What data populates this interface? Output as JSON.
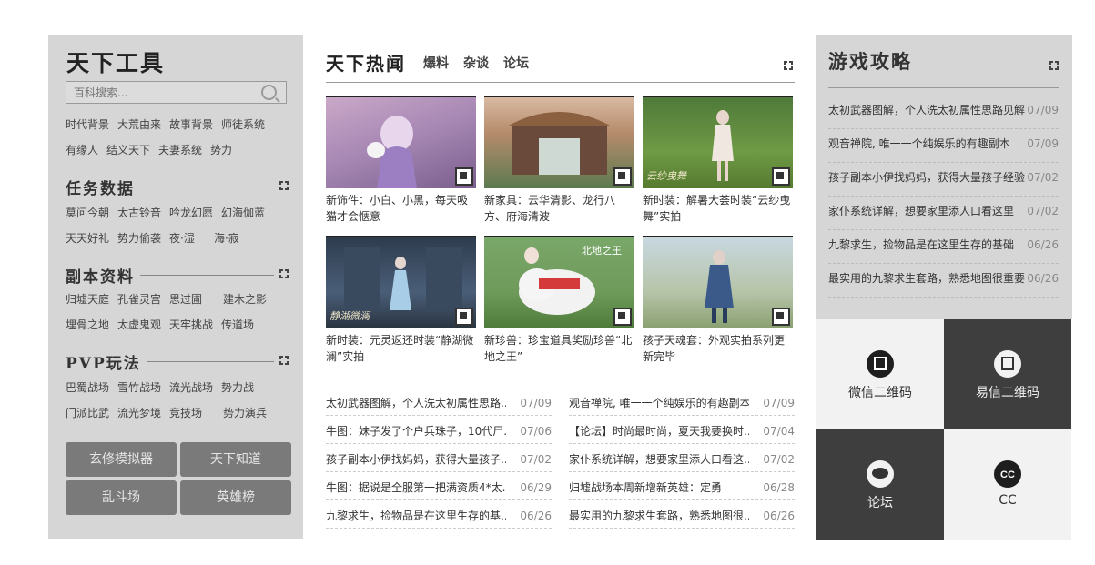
{
  "tools": {
    "title": "天下工具",
    "search_placeholder": "百科搜索...",
    "links_rows": [
      [
        "时代背景",
        "大荒由来",
        "故事背景",
        "师徒系统"
      ],
      [
        "有缘人",
        "结义天下",
        "夫妻系统",
        "势力"
      ]
    ],
    "sections": [
      {
        "label": "任务数据",
        "rows": [
          [
            "莫问今朝",
            "太古铃音",
            "吟龙幻愿",
            "幻海伽蓝"
          ],
          [
            "天天好礼",
            "势力偷袭",
            "夜·湿",
            "海·寂"
          ]
        ]
      },
      {
        "label": "副本资料",
        "rows": [
          [
            "归墟天庭",
            "孔雀灵宫",
            "思过圃",
            "建木之影"
          ],
          [
            "埋骨之地",
            "太虚鬼观",
            "天牢挑战",
            "传道场"
          ]
        ]
      },
      {
        "label": "PVP玩法",
        "rows": [
          [
            "巴蜀战场",
            "雪竹战场",
            "流光战场",
            "势力战"
          ],
          [
            "门派比武",
            "流光梦境",
            "竞技场",
            "势力演兵"
          ]
        ]
      }
    ],
    "buttons": [
      "玄修模拟器",
      "天下知道",
      "乱斗场",
      "英雄榜"
    ]
  },
  "hot": {
    "title": "天下热闻",
    "tabs": [
      "爆料",
      "杂谈",
      "论坛"
    ],
    "cards": [
      {
        "caption": "新饰件：小白、小黑，每天吸猫才会惬意"
      },
      {
        "caption": "新家具：云华清影、龙行八方、府海清波"
      },
      {
        "caption": "新时装：解暑大荟时装“云纱曳舞”实拍",
        "overlay": "云纱曳舞"
      },
      {
        "caption": "新时装：元灵返还时装“静湖微澜”实拍",
        "overlay": "静湖微澜"
      },
      {
        "caption": "新珍兽：珍宝道具奖励珍兽“北地之王”",
        "overlay": "北地之王"
      },
      {
        "caption": "孩子天魂套：外观实拍系列更新完毕"
      }
    ],
    "news_left": [
      {
        "title": "太初武器图解，个人洗太初属性思路..",
        "date": "07/09"
      },
      {
        "title": "牛图：妹子发了个户兵珠子，10代尸.",
        "date": "07/06"
      },
      {
        "title": "孩子副本小伊找妈妈，获得大量孩子..",
        "date": "07/02"
      },
      {
        "title": "牛图：据说是全服第一把满资质4*太..",
        "date": "06/29"
      },
      {
        "title": "九黎求生，捡物品是在这里生存的基..",
        "date": "06/26"
      }
    ],
    "news_right": [
      {
        "title": "观音禅院, 唯一一个纯娱乐的有趣副本",
        "date": "07/09"
      },
      {
        "title": "【论坛】时尚最时尚，夏天我要换时..",
        "date": "07/04"
      },
      {
        "title": "家仆系统详解，想要家里添人口看这..",
        "date": "07/02"
      },
      {
        "title": "归墟战场本周新增新英雄：定勇",
        "date": "06/28"
      },
      {
        "title": "最实用的九黎求生套路，熟悉地图很..",
        "date": "06/26"
      }
    ]
  },
  "guides": {
    "title": "游戏攻略",
    "items": [
      {
        "title": "太初武器图解，个人洗太初属性思路见解",
        "date": "07/09"
      },
      {
        "title": "观音禅院, 唯一一个纯娱乐的有趣副本",
        "date": "07/09"
      },
      {
        "title": "孩子副本小伊找妈妈，获得大量孩子经验",
        "date": "07/02"
      },
      {
        "title": "家仆系统详解，想要家里添人口看这里",
        "date": "07/02"
      },
      {
        "title": "九黎求生，捡物品是在这里生存的基础",
        "date": "06/26"
      },
      {
        "title": "最实用的九黎求生套路，熟悉地图很重要",
        "date": "06/26"
      }
    ]
  },
  "social": {
    "tiles": [
      {
        "label": "微信二维码",
        "icon": "wechat-qr-icon"
      },
      {
        "label": "易信二维码",
        "icon": "yixin-qr-icon"
      },
      {
        "label": "论坛",
        "icon": "forum-icon"
      },
      {
        "label": "CC",
        "icon": "cc-icon"
      }
    ]
  },
  "colors": {
    "panel_bg": "#d6d6d6",
    "button_bg": "#7a7a7a",
    "dark_tile": "#3e3e3e",
    "light_tile": "#f2f2f2"
  }
}
